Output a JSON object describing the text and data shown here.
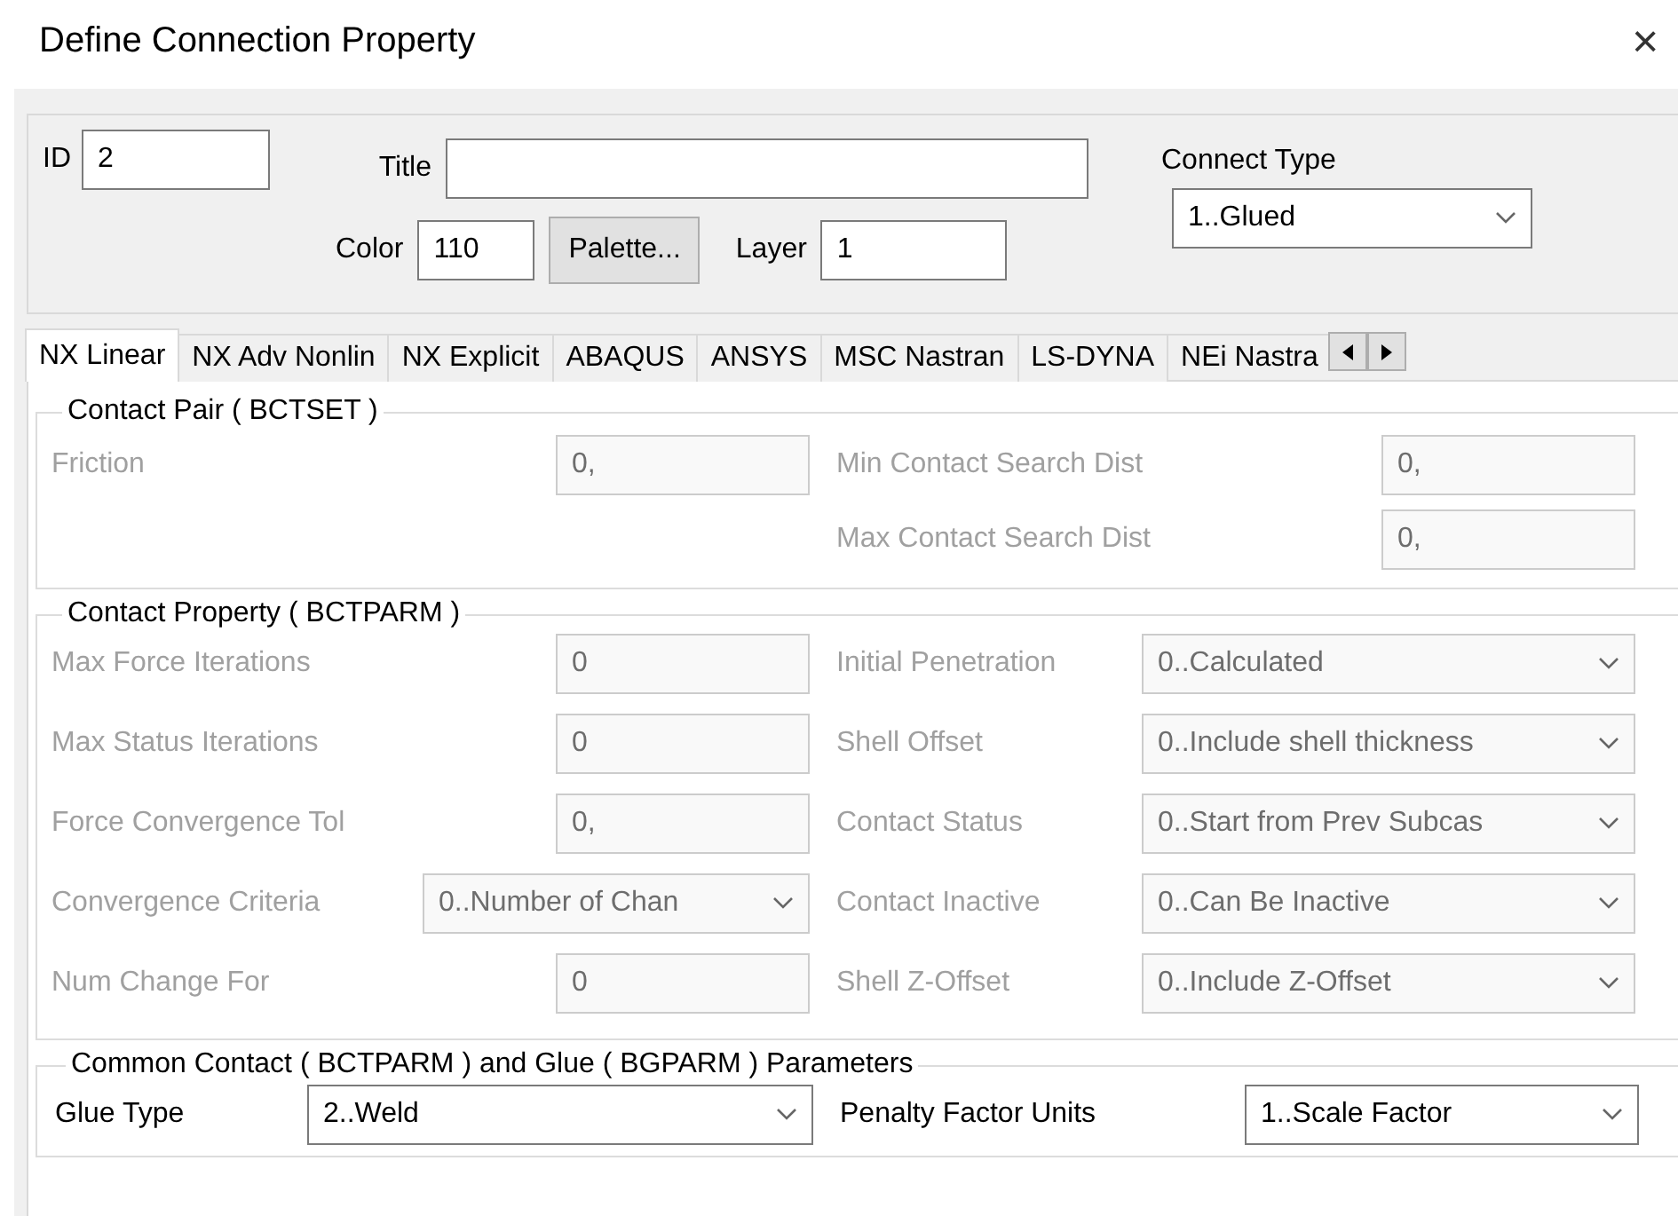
{
  "window": {
    "title": "Define Connection Property",
    "close": "×"
  },
  "header": {
    "id": {
      "label": "ID",
      "value": "2"
    },
    "title": {
      "label": "Title"
    },
    "color": {
      "label": "Color",
      "value": "110"
    },
    "palette_button": "Palette...",
    "layer": {
      "label": "Layer",
      "value": "1"
    },
    "connect_type": {
      "label": "Connect Type",
      "value": "1..Glued"
    }
  },
  "tabs": [
    {
      "label": "NX Linear",
      "selected": true
    },
    {
      "label": "NX Adv Nonlin",
      "selected": false
    },
    {
      "label": "NX Explicit",
      "selected": false
    },
    {
      "label": "ABAQUS",
      "selected": false
    },
    {
      "label": "ANSYS",
      "selected": false
    },
    {
      "label": "MSC Nastran",
      "selected": false
    },
    {
      "label": "LS-DYNA",
      "selected": false
    },
    {
      "label": "NEi Nastra",
      "selected": false
    }
  ],
  "sections": [
    {
      "title": "Contact Pair ( BCTSET )",
      "rows": [
        {
          "left": {
            "label": "Friction",
            "value": "0,",
            "kind": "input",
            "disabled": true
          },
          "right": {
            "label": "Min Contact Search Dist",
            "value": "0,",
            "kind": "input",
            "disabled": true
          }
        },
        {
          "right": {
            "label": "Max Contact Search Dist",
            "value": "0,",
            "kind": "input",
            "disabled": true
          }
        }
      ]
    },
    {
      "title": "Contact Property ( BCTPARM )",
      "rows": [
        {
          "left": {
            "label": "Max Force Iterations",
            "value": "0",
            "kind": "input",
            "disabled": true
          },
          "right": {
            "label": "Initial Penetration",
            "value": "0..Calculated",
            "kind": "select",
            "disabled": true
          }
        },
        {
          "left": {
            "label": "Max Status Iterations",
            "value": "0",
            "kind": "input",
            "disabled": true
          },
          "right": {
            "label": "Shell Offset",
            "value": "0..Include shell thickness",
            "kind": "select",
            "disabled": true
          }
        },
        {
          "left": {
            "label": "Force Convergence Tol",
            "value": "0,",
            "kind": "input",
            "disabled": true
          },
          "right": {
            "label": "Contact Status",
            "value": "0..Start from Prev Subcas",
            "kind": "select",
            "disabled": true
          }
        },
        {
          "left": {
            "label": "Convergence Criteria",
            "value": "0..Number of Chan",
            "kind": "select",
            "disabled": true
          },
          "right": {
            "label": "Contact Inactive",
            "value": "0..Can Be Inactive",
            "kind": "select",
            "disabled": true
          }
        },
        {
          "left": {
            "label": "Num Change For",
            "value": "0",
            "kind": "input",
            "disabled": true
          },
          "right": {
            "label": "Shell Z-Offset",
            "value": "0..Include Z-Offset",
            "kind": "select",
            "disabled": true
          }
        }
      ]
    },
    {
      "title": "Common Contact ( BCTPARM ) and Glue ( BGPARM ) Parameters",
      "rows": [
        {
          "left": {
            "label": "Glue Type",
            "value": "2..Weld",
            "kind": "select",
            "disabled": false
          },
          "right": {
            "label": "Penalty Factor Units",
            "value": "1..Scale Factor",
            "kind": "select",
            "disabled": false
          }
        }
      ]
    }
  ]
}
